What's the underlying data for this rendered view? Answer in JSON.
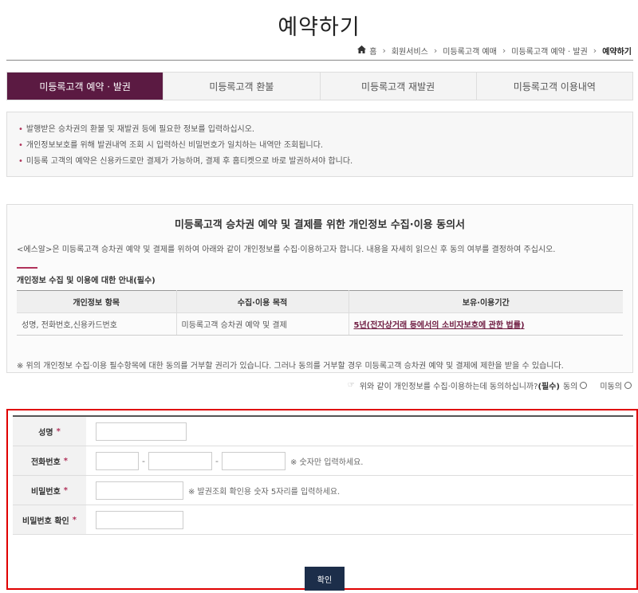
{
  "page": {
    "title": "예약하기"
  },
  "breadcrumb": {
    "home": "홈",
    "items": [
      "회원서비스",
      "미등록고객 예매",
      "미등록고객 예약 · 발권"
    ],
    "current": "예약하기"
  },
  "tabs": [
    {
      "label": "미등록고객 예약 · 발권",
      "active": true
    },
    {
      "label": "미등록고객 환불",
      "active": false
    },
    {
      "label": "미등록고객 재발권",
      "active": false
    },
    {
      "label": "미등록고객 이용내역",
      "active": false
    }
  ],
  "notice": {
    "items": [
      "발행받은 승차권의 환불 및 재발권 등에 필요한 정보를 입력하십시오.",
      "개인정보보호를 위해 발권내역 조회 시 입력하신 비밀번호가 일치하는 내역만 조회됩니다.",
      "미등록 고객의 예약은 신용카드로만 결제가 가능하며, 결제 후 홈티켓으로 바로 발권하셔야 합니다."
    ]
  },
  "consent": {
    "title": "미등록고객 승차권 예약 및 결제를 위한 개인정보 수집·이용 동의서",
    "description": "<에스알>은 미등록고객 승차권 예약 및 결제를 위하여 아래와 같이 개인정보를 수집·이용하고자 합니다. 내용을 자세히 읽으신 후 동의 여부를 결정하여 주십시오.",
    "guide_title": "개인정보 수집 및 이용에 대한 안내(필수)",
    "table": {
      "headers": [
        "개인정보 항목",
        "수집·이용 목적",
        "보유·이용기간"
      ],
      "row": [
        "성명, 전화번호,신용카드번호",
        "미등록고객 승차권 예약 및 결제",
        "5년(전자상거래 등에서의 소비자보호에 관한 법률)"
      ]
    },
    "note": "※ 위의 개인정보 수집·이용 필수항목에 대한 동의를 거부할 권리가 있습니다. 그러나 동의를 거부할 경우 미등록고객 승차권 예약 및 결제에 제한을 받을 수 있습니다."
  },
  "agree": {
    "question": "위와 같이 개인정보를 수집·이용하는데 동의하십니까?",
    "required": "(필수)",
    "agree_label": "동의",
    "disagree_label": "미동의"
  },
  "form": {
    "name_label": "성명",
    "phone_label": "전화번호",
    "phone_hint": "※ 숫자만 입력하세요.",
    "password_label": "비밀번호",
    "password_hint": "※ 발권조회 확인용 숫자 5자리를 입력하세요.",
    "password_confirm_label": "비밀번호 확인",
    "required_mark": "*",
    "dash": "-",
    "confirm_button": "확인"
  },
  "colors": {
    "accent": "#5b1a42",
    "button": "#1c2e4a",
    "highlight_border": "#e00000"
  }
}
